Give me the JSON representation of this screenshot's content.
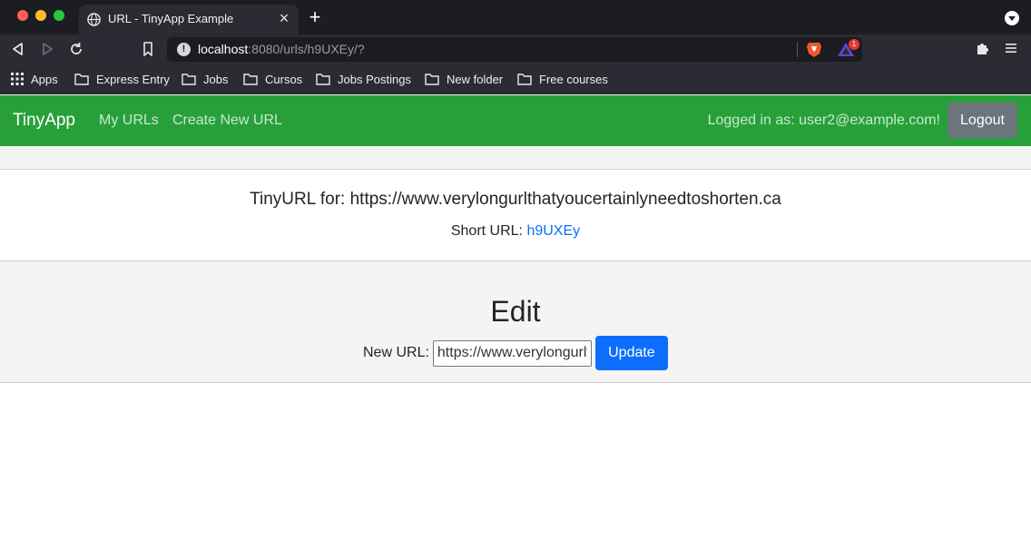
{
  "browser": {
    "tab_title": "URL - TinyApp Example",
    "tab_close": "×",
    "new_tab": "+",
    "address_host": "localhost",
    "address_path": ":8080/urls/h9UXEy/?",
    "rewards_badge": "1",
    "bookmarks": [
      {
        "label": "Apps",
        "icon": "apps-grid-icon"
      },
      {
        "label": "Express Entry",
        "icon": "folder-icon"
      },
      {
        "label": "Jobs",
        "icon": "folder-icon"
      },
      {
        "label": "Cursos",
        "icon": "folder-icon"
      },
      {
        "label": "Jobs Postings",
        "icon": "folder-icon"
      },
      {
        "label": "New folder",
        "icon": "folder-icon"
      },
      {
        "label": "Free courses",
        "icon": "folder-icon"
      }
    ]
  },
  "navbar": {
    "brand": "TinyApp",
    "links": [
      "My URLs",
      "Create New URL"
    ],
    "logged_in_text": "Logged in as: user2@example.com!",
    "logout_label": "Logout"
  },
  "card": {
    "title": "TinyURL for: https://www.verylongurlthatyoucertainlyneedtoshorten.ca",
    "short_label": "Short URL: ",
    "short_value": "h9UXEy"
  },
  "edit": {
    "title": "Edit",
    "label": "New URL:",
    "input_value": "https://www.verylongurlthatyoucertainlyneedtoshorten.ca",
    "button_label": "Update"
  },
  "colors": {
    "navbar_bg": "#28a03a",
    "link_blue": "#0d6efd",
    "logout_bg": "#6c757d"
  }
}
